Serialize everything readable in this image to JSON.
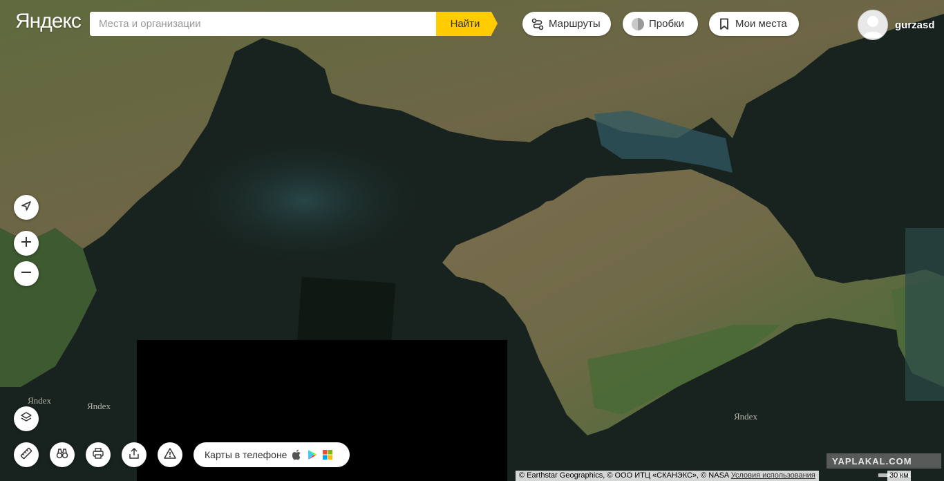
{
  "header": {
    "logo": "Яндекс",
    "search_placeholder": "Места и организации",
    "search_button": "Найти",
    "routes_label": "Маршруты",
    "traffic_label": "Пробки",
    "my_places_label": "Мои места",
    "username": "gurzasd"
  },
  "controls": {
    "left": [
      "locate-icon",
      "zoom-in-icon",
      "zoom-out-icon",
      "layers-icon"
    ],
    "bottom": [
      "ruler-icon",
      "panorama-icon",
      "print-icon",
      "share-icon",
      "warning-icon"
    ]
  },
  "phone_promo": {
    "label": "Карты в телефоне",
    "stores": [
      "apple-icon",
      "google-play-icon",
      "windows-store-icon"
    ]
  },
  "watermarks": [
    "Яndex",
    "Яndex",
    "Яndex"
  ],
  "site_watermark": "YAPLAKAL.COM",
  "footer": {
    "copyright": "© Earthstar Geographics, © ООО ИТЦ «СКАНЭКС», © NASA",
    "terms_link": "Условия использования",
    "scale": "30 км"
  },
  "colors": {
    "search_button": "#ffcc00",
    "sea": "#18231f",
    "land": "#5b5a3e"
  }
}
